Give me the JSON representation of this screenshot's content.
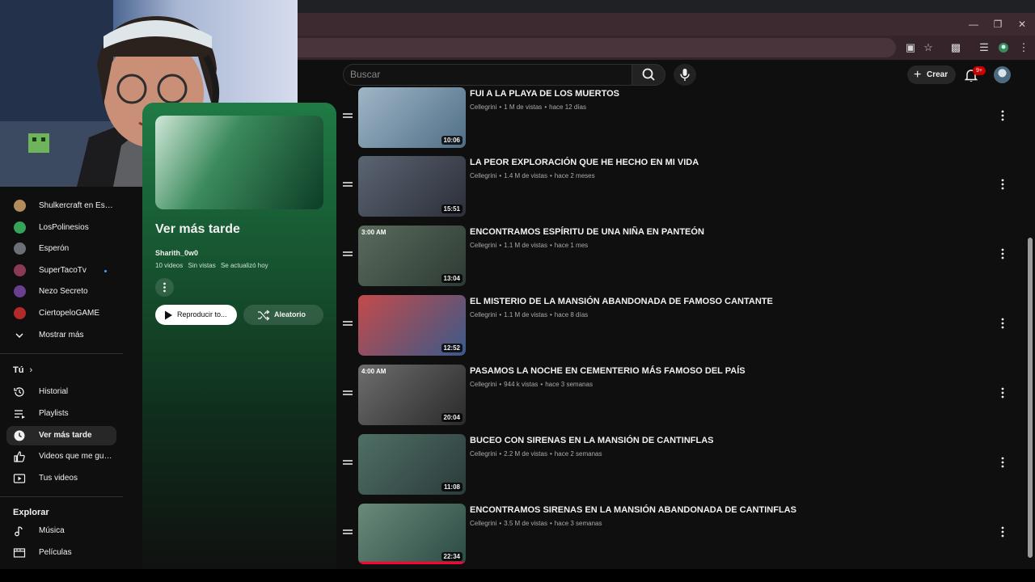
{
  "header": {
    "search_placeholder": "Buscar",
    "create_label": "Crear",
    "notifications_badge": "9+"
  },
  "sidebar": {
    "subscriptions": [
      {
        "label": "Shulkercraft en Esp...",
        "color": "#b48c5c"
      },
      {
        "label": "LosPolinesios",
        "color": "#35a35a"
      },
      {
        "label": "Esperón",
        "color": "#6a6f78"
      },
      {
        "label": "SuperTacoTv",
        "color": "#8a3a55",
        "live_dot": true
      },
      {
        "label": "Nezo Secreto",
        "color": "#6a3f8f"
      },
      {
        "label": "CiertopeloGAME",
        "color": "#b22a2a"
      },
      {
        "label": "Mostrar más"
      }
    ],
    "you_heading": "Tú",
    "you_items": [
      {
        "label": "Historial",
        "icon": "history-icon"
      },
      {
        "label": "Playlists",
        "icon": "playlists-icon"
      },
      {
        "label": "Ver más tarde",
        "icon": "clock-icon",
        "active": true
      },
      {
        "label": "Videos que me gus...",
        "icon": "thumbs-up-icon"
      },
      {
        "label": "Tus videos",
        "icon": "your-videos-icon"
      }
    ],
    "explore_heading": "Explorar",
    "explore_items": [
      {
        "label": "Música",
        "icon": "music-icon"
      },
      {
        "label": "Películas",
        "icon": "movies-icon"
      }
    ]
  },
  "playlist": {
    "title": "Ver más tarde",
    "owner": "Sharith_0w0",
    "video_count": "10 videos",
    "views": "Sin vistas",
    "updated": "Se actualizó hoy",
    "play_label": "Reproducir to...",
    "shuffle_label": "Aleatorio"
  },
  "videos": [
    {
      "title": "FUI A LA PLAYA DE LOS MUERTOS",
      "channel": "Cellegrini",
      "views": "1 M de vistas",
      "age": "hace 12 días",
      "duration": "10:06",
      "badge": "",
      "colors": [
        "#9fb6c6",
        "#4f6e86"
      ]
    },
    {
      "title": "LA PEOR EXPLORACIÓN QUE HE HECHO EN MI VIDA",
      "channel": "Cellegrini",
      "views": "1.4 M de vistas",
      "age": "hace 2 meses",
      "duration": "15:51",
      "badge": "",
      "colors": [
        "#5b6472",
        "#2b2f39"
      ]
    },
    {
      "title": "ENCONTRAMOS ESPÍRITU DE UNA NIÑA EN PANTEÓN",
      "channel": "Cellegrini",
      "views": "1.1 M de vistas",
      "age": "hace 1 mes",
      "duration": "13:04",
      "badge": "3:00 AM",
      "colors": [
        "#5a6b5c",
        "#2d3a34"
      ]
    },
    {
      "title": "EL MISTERIO DE LA MANSIÓN ABANDONADA DE FAMOSO CANTANTE",
      "channel": "Cellegrini",
      "views": "1.1 M de vistas",
      "age": "hace 8 días",
      "duration": "12:52",
      "badge": "",
      "colors": [
        "#c44a4a",
        "#3a5a8a"
      ]
    },
    {
      "title": "PASAMOS LA NOCHE EN CEMENTERIO MÁS FAMOSO DEL PAÍS",
      "channel": "Cellegrini",
      "views": "944 k vistas",
      "age": "hace 3 semanas",
      "duration": "20:04",
      "badge": "4:00 AM",
      "colors": [
        "#6d6d6d",
        "#2a2a2a"
      ]
    },
    {
      "title": "BUCEO CON SIRENAS EN LA MANSIÓN DE CANTINFLAS",
      "channel": "Cellegrini",
      "views": "2.2 M de vistas",
      "age": "hace 2 semanas",
      "duration": "11:08",
      "badge": "",
      "colors": [
        "#4f6f66",
        "#2b3b3a"
      ]
    },
    {
      "title": "ENCONTRAMOS SIRENAS EN LA MANSIÓN ABANDONADA DE CANTINFLAS",
      "channel": "Cellegrini",
      "views": "3.5 M de vistas",
      "age": "hace 3 semanas",
      "duration": "22:34",
      "badge": "",
      "colors": [
        "#6a8a7a",
        "#2b4a44"
      ],
      "progress": 1.0
    }
  ]
}
